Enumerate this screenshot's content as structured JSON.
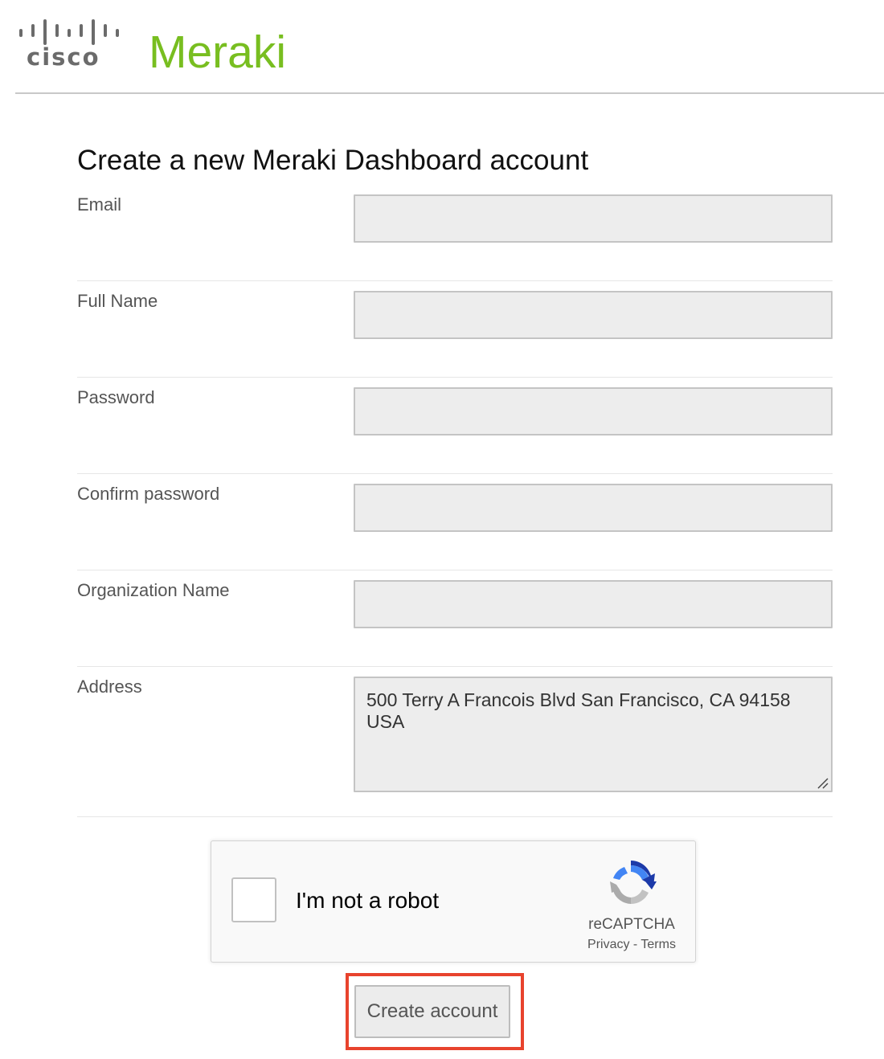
{
  "header": {
    "cisco_logo_text": "cisco",
    "meraki_logo_text": "Meraki",
    "colors": {
      "cisco_gray": "#6b6b6b",
      "meraki_green": "#78be20"
    }
  },
  "page": {
    "title": "Create a new Meraki Dashboard account"
  },
  "form": {
    "fields": {
      "email": {
        "label": "Email",
        "value": ""
      },
      "full_name": {
        "label": "Full Name",
        "value": ""
      },
      "password": {
        "label": "Password",
        "value": ""
      },
      "confirm_password": {
        "label": "Confirm password",
        "value": ""
      },
      "organization_name": {
        "label": "Organization Name",
        "value": ""
      },
      "address": {
        "label": "Address",
        "value": "500 Terry A Francois Blvd San Francisco, CA 94158 USA"
      }
    }
  },
  "recaptcha": {
    "checkbox_label": "I'm not a robot",
    "brand": "reCAPTCHA",
    "privacy_link": "Privacy",
    "separator": " - ",
    "terms_link": "Terms",
    "checked": false
  },
  "submit": {
    "label": "Create account",
    "highlight_color": "#e8432d"
  }
}
